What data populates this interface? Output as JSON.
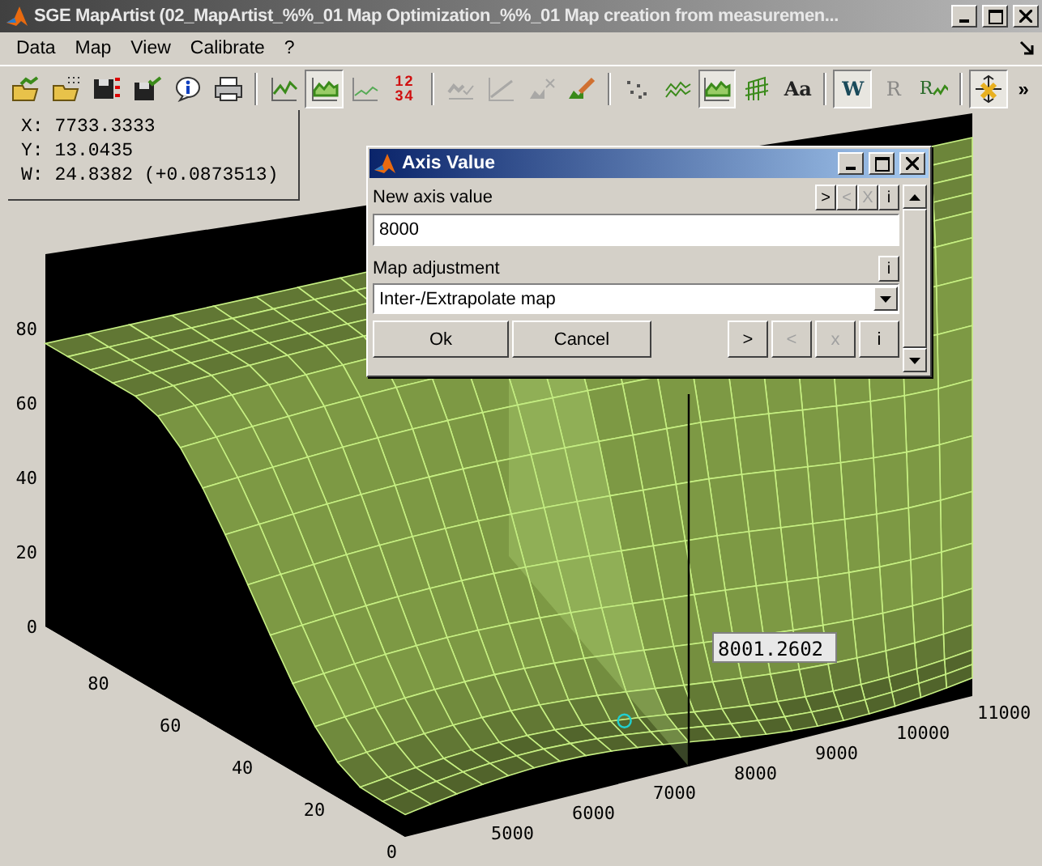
{
  "window": {
    "title": "SGE MapArtist (02_MapArtist_%%_01 Map Optimization_%%_01 Map creation from measuremen..."
  },
  "menu": [
    "Data",
    "Map",
    "View",
    "Calibrate",
    "?"
  ],
  "toolbar": [
    [
      {
        "kind": "folder",
        "selected": false,
        "disabled": false
      },
      {
        "kind": "folder-grid",
        "selected": false,
        "disabled": false
      },
      {
        "kind": "save",
        "selected": false,
        "disabled": false
      },
      {
        "kind": "save-check",
        "selected": false,
        "disabled": false
      },
      {
        "kind": "info",
        "selected": false,
        "disabled": false
      },
      {
        "kind": "printer",
        "selected": false,
        "disabled": false
      }
    ],
    [
      {
        "kind": "line-chart",
        "selected": false,
        "disabled": false
      },
      {
        "kind": "area-chart",
        "selected": true,
        "disabled": false
      },
      {
        "kind": "thin-chart",
        "selected": false,
        "disabled": false
      },
      {
        "kind": "numbers",
        "label": "1234",
        "selected": false,
        "disabled": false
      }
    ],
    [
      {
        "kind": "check-chart",
        "selected": false,
        "disabled": true
      },
      {
        "kind": "trend-chart",
        "selected": false,
        "disabled": true
      },
      {
        "kind": "x-chart",
        "selected": false,
        "disabled": true
      },
      {
        "kind": "pencil",
        "selected": false,
        "disabled": false
      }
    ],
    [
      {
        "kind": "scatter",
        "selected": false,
        "disabled": false
      },
      {
        "kind": "mesh",
        "selected": false,
        "disabled": false
      },
      {
        "kind": "area-chart",
        "selected": true,
        "disabled": false
      },
      {
        "kind": "waterfall",
        "selected": false,
        "disabled": false
      },
      {
        "kind": "letters",
        "label": "Aa",
        "selected": false,
        "disabled": false
      }
    ],
    [
      {
        "kind": "letters",
        "label": "W",
        "selected": true,
        "disabled": false
      },
      {
        "kind": "letters",
        "label": "R",
        "selected": false,
        "disabled": true
      },
      {
        "kind": "r-chart",
        "label": "R",
        "selected": false,
        "disabled": false
      }
    ],
    [
      {
        "kind": "cursor",
        "selected": true,
        "disabled": false
      }
    ]
  ],
  "toolbar_more": "»",
  "readout": [
    "X: 7733.3333",
    "Y: 13.0435",
    "W: 24.8382 (+0.0873513)"
  ],
  "plot": {
    "z_ticks": [
      "80",
      "60",
      "40",
      "20",
      "0"
    ],
    "y_ticks": [
      "0",
      "20",
      "40",
      "60",
      "80"
    ],
    "x_ticks": [
      "5000",
      "6000",
      "7000",
      "8000",
      "9000",
      "10000",
      "11000"
    ],
    "tooltip": "8001.2602"
  },
  "dialog": {
    "title": "Axis Value",
    "field_label": "New axis value",
    "field_buttons": [
      {
        "label": ">",
        "disabled": false
      },
      {
        "label": "<",
        "disabled": true
      },
      {
        "label": "X",
        "disabled": true
      },
      {
        "label": "i",
        "disabled": false
      }
    ],
    "value": "8000",
    "select_label": "Map adjustment",
    "select_info": "i",
    "select_value": "Inter-/Extrapolate map",
    "buttons": [
      "Ok",
      "Cancel"
    ],
    "nav_buttons": [
      {
        "label": ">",
        "disabled": false
      },
      {
        "label": "<",
        "disabled": true
      },
      {
        "label": "x",
        "disabled": true
      },
      {
        "label": "i",
        "disabled": false
      }
    ]
  }
}
